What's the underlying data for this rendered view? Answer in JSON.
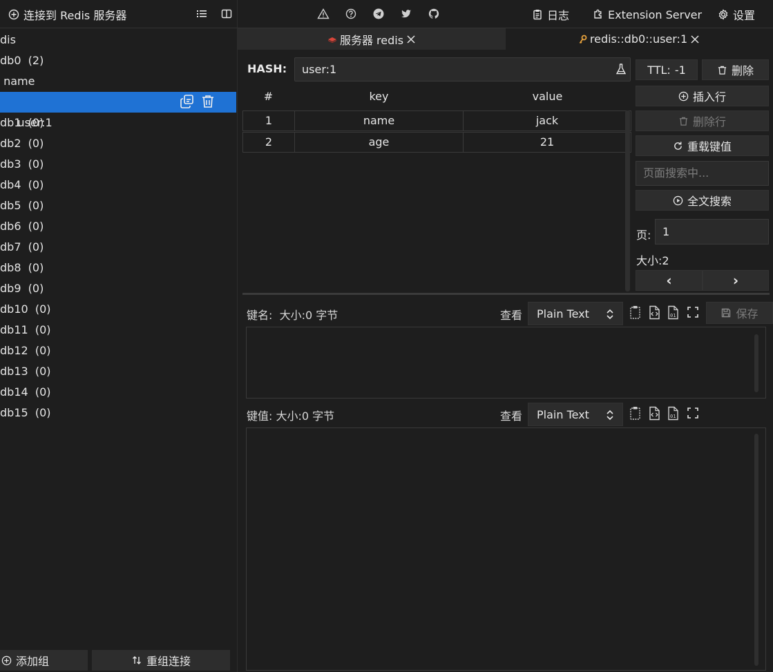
{
  "sidebar": {
    "connect_label": "连接到 Redis 服务器",
    "tree": [
      {
        "label": "dis",
        "selected": false
      },
      {
        "label": "db0  (2)",
        "selected": false
      },
      {
        "label": " name",
        "selected": false
      },
      {
        "label": " user:1",
        "selected": true
      },
      {
        "label": "db1  (0)",
        "selected": false
      },
      {
        "label": "db2  (0)",
        "selected": false
      },
      {
        "label": "db3  (0)",
        "selected": false
      },
      {
        "label": "db4  (0)",
        "selected": false
      },
      {
        "label": "db5  (0)",
        "selected": false
      },
      {
        "label": "db6  (0)",
        "selected": false
      },
      {
        "label": "db7  (0)",
        "selected": false
      },
      {
        "label": "db8  (0)",
        "selected": false
      },
      {
        "label": "db9  (0)",
        "selected": false
      },
      {
        "label": "db10  (0)",
        "selected": false
      },
      {
        "label": "db11  (0)",
        "selected": false
      },
      {
        "label": "db12  (0)",
        "selected": false
      },
      {
        "label": "db13  (0)",
        "selected": false
      },
      {
        "label": "db14  (0)",
        "selected": false
      },
      {
        "label": "db15  (0)",
        "selected": false
      }
    ],
    "add_group": "添加组",
    "regroup": "重组连接"
  },
  "topbar": {
    "log_label": "日志",
    "extension_label": "Extension Server",
    "settings_label": "设置"
  },
  "tabs": [
    {
      "label": "服务器 redis",
      "active": false
    },
    {
      "label": "redis::db0::user:1",
      "active": true
    }
  ],
  "key_panel": {
    "type_label": "HASH:",
    "key_name": "user:1",
    "ttl_label": "TTL:",
    "ttl_value": "-1",
    "delete_label": "删除",
    "insert_row": "插入行",
    "delete_row": "删除行",
    "reload": "重载键值",
    "search_placeholder": "页面搜索中...",
    "fulltext_search": "全文搜索",
    "page_label": "页:",
    "page_value": "1",
    "size_label": "大小:",
    "size_value": "2",
    "prev": "‹",
    "next": "›"
  },
  "table": {
    "headers": [
      "#",
      "key",
      "value"
    ],
    "rows": [
      [
        "1",
        "name",
        "jack"
      ],
      [
        "2",
        "age",
        "21"
      ]
    ]
  },
  "key_editor": {
    "label": "键名:  大小:0 字节",
    "view_label": "查看",
    "format": "Plain Text",
    "save_label": "保存"
  },
  "value_editor": {
    "label": "键值: 大小:0 字节",
    "view_label": "查看",
    "format": "Plain Text"
  },
  "colors": {
    "background": "#1e1e1e",
    "selected": "#1f72d4",
    "button": "#2d2d2d",
    "redis_red": "#d9463a",
    "key_gold": "#e8a33d"
  }
}
